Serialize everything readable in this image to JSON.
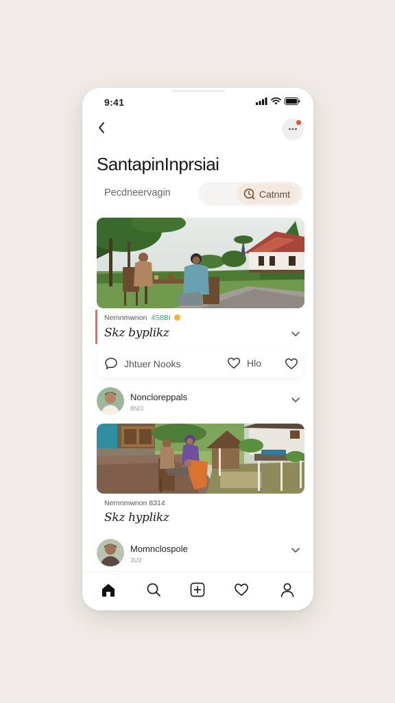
{
  "status": {
    "time": "9:41"
  },
  "header": {
    "title": "SantapinInprsiai",
    "subtitle": "Pecdneervagin",
    "search_label": "Catnmt"
  },
  "posts": [
    {
      "meta": "Nernnmwnon",
      "tag": "4S8BI",
      "title": "Skz byplikz",
      "actions": {
        "first": "Jhtuer Nooks",
        "second": "Hlo"
      }
    },
    {
      "meta": "Nernnmwnon  8314",
      "title": "Skz hyplikz"
    }
  ],
  "people": [
    {
      "name": "Noncloreppals",
      "meta": "8NI3"
    },
    {
      "name": "Momnclospole",
      "meta": "3U3"
    }
  ],
  "icons": {
    "back": "chevron-left-icon",
    "more": "more-dots-icon",
    "search": "search-icon",
    "chevron": "chevron-down-icon",
    "comment": "comment-icon",
    "like": "heart-icon",
    "nav": [
      "home-icon",
      "search-icon",
      "add-icon",
      "heart-icon",
      "profile-icon"
    ]
  },
  "colors": {
    "accent": "#e8685a",
    "notification": "#e84b3c",
    "tag": "#2fa86a",
    "search_text": "#6a4a33"
  }
}
